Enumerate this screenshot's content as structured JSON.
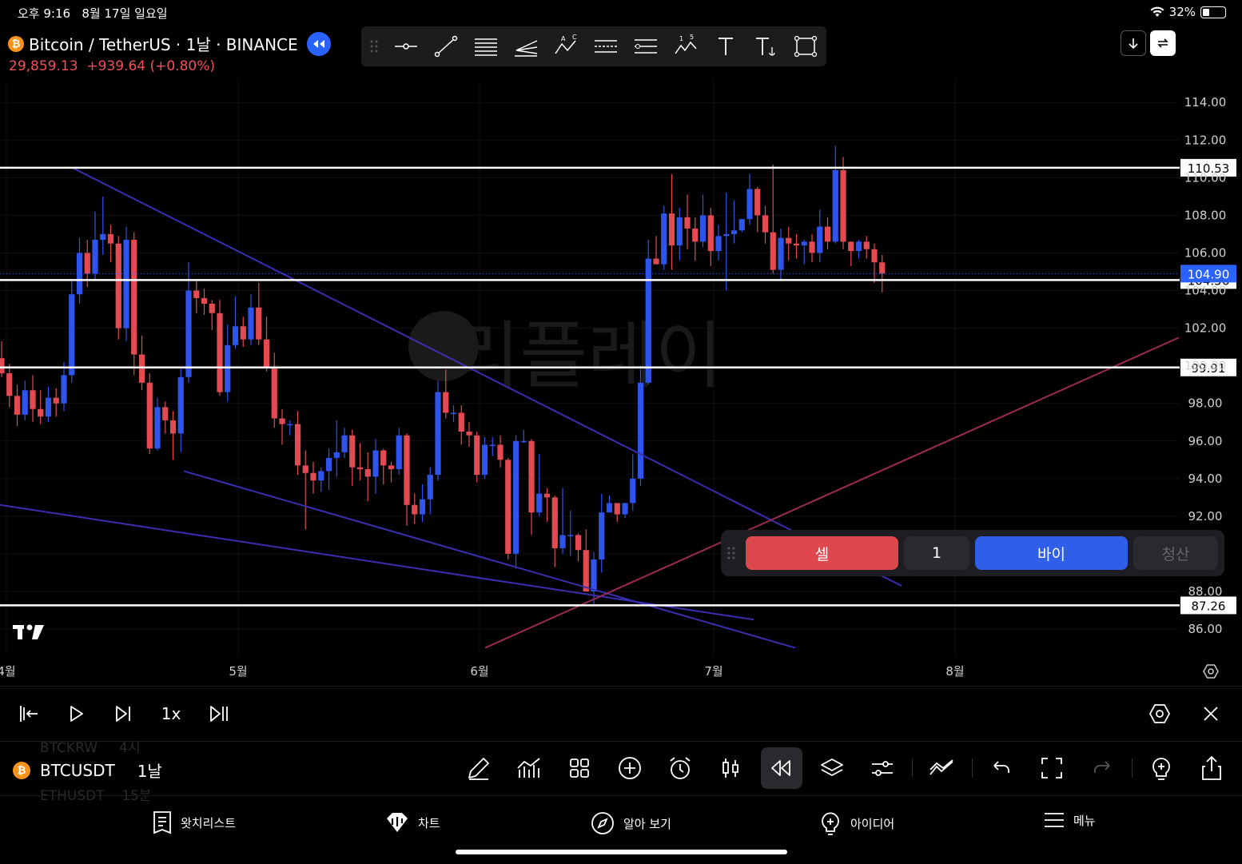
{
  "status_bar": {
    "time": "오후 9:16",
    "date": "8월 17일 일요일",
    "battery": "32%"
  },
  "symbol": {
    "title": "Bitcoin / TetherUS · 1날 · BINANCE",
    "price": "29,859.13",
    "change": "+939.64 (+0.80%)",
    "ticker": "BTCUSDT",
    "interval": "1날"
  },
  "watchlist_ghost": {
    "prev_ticker": "BTCKRW",
    "prev_interval": "4시",
    "next_ticker": "ETHUSDT",
    "next_interval": "15분"
  },
  "watermark": "리플레이",
  "chart_data": {
    "type": "candlestick",
    "y_axis": {
      "min": 84.6,
      "max": 115.2,
      "ticks": [
        "114.00",
        "112.00",
        "110.00",
        "108.00",
        "106.00",
        "104.00",
        "102.00",
        "100.00",
        "98.00",
        "96.00",
        "94.00",
        "92.00",
        "90.00",
        "88.00",
        "86.00"
      ]
    },
    "x_axis": {
      "labels": [
        "4월",
        "5월",
        "6월",
        "7월",
        "8월"
      ]
    },
    "horizontal_lines": [
      {
        "label": "110.53",
        "value": 110.53
      },
      {
        "label": "104.56",
        "value": 104.56
      },
      {
        "label": "99.91",
        "value": 99.91
      },
      {
        "label": "87.26",
        "value": 87.26
      }
    ],
    "current_price": {
      "label": "104.90",
      "value": 104.9
    },
    "colors": {
      "up": "#2f54eb",
      "down": "#e34a52",
      "trendline": "#3a2fb0",
      "support_line": "#9b2a56",
      "price_tag": "#2962ff"
    },
    "candles": [
      [
        100.4,
        99.6,
        101.3,
        99.4
      ],
      [
        99.6,
        98.4,
        100.1,
        97.8
      ],
      [
        98.4,
        97.4,
        99.0,
        96.8
      ],
      [
        97.4,
        98.7,
        99.2,
        97.1
      ],
      [
        98.7,
        97.7,
        99.5,
        97.0
      ],
      [
        97.7,
        97.3,
        98.7,
        96.9
      ],
      [
        97.3,
        98.3,
        98.9,
        97.0
      ],
      [
        98.3,
        98.0,
        98.8,
        97.3
      ],
      [
        98.0,
        99.5,
        100.2,
        97.6
      ],
      [
        99.5,
        103.8,
        104.5,
        99.1
      ],
      [
        103.8,
        106.0,
        106.8,
        103.3
      ],
      [
        106.0,
        104.9,
        106.7,
        104.2
      ],
      [
        104.9,
        106.7,
        108.2,
        104.6
      ],
      [
        106.7,
        107.0,
        109.0,
        105.9
      ],
      [
        107.0,
        106.5,
        107.5,
        105.5
      ],
      [
        106.5,
        102.0,
        106.9,
        101.4
      ],
      [
        102.0,
        106.7,
        107.4,
        101.3
      ],
      [
        106.7,
        100.6,
        107.1,
        99.5
      ],
      [
        100.6,
        99.1,
        101.6,
        98.7
      ],
      [
        99.1,
        95.6,
        99.6,
        95.3
      ],
      [
        95.6,
        97.8,
        98.3,
        95.5
      ],
      [
        97.8,
        97.1,
        98.1,
        96.4
      ],
      [
        97.1,
        96.4,
        97.6,
        95.0
      ],
      [
        96.4,
        99.4,
        99.9,
        95.4
      ],
      [
        99.4,
        104.0,
        105.5,
        99.1
      ],
      [
        104.0,
        103.6,
        104.6,
        102.8
      ],
      [
        103.6,
        103.3,
        104.1,
        102.7
      ],
      [
        103.3,
        102.8,
        103.5,
        101.9
      ],
      [
        102.8,
        98.6,
        103.5,
        98.4
      ],
      [
        98.6,
        101.1,
        102.2,
        98.1
      ],
      [
        101.1,
        102.1,
        103.7,
        100.9
      ],
      [
        102.1,
        101.4,
        102.6,
        101.0
      ],
      [
        101.4,
        103.1,
        103.8,
        101.1
      ],
      [
        103.1,
        101.4,
        104.4,
        101.1
      ],
      [
        101.4,
        99.9,
        102.6,
        99.7
      ],
      [
        99.9,
        97.2,
        100.7,
        96.7
      ],
      [
        97.2,
        96.9,
        97.7,
        95.8
      ],
      [
        96.9,
        96.9,
        97.1,
        96.3
      ],
      [
        96.9,
        94.7,
        97.6,
        94.2
      ],
      [
        94.7,
        94.3,
        95.5,
        91.3
      ],
      [
        94.3,
        93.9,
        94.9,
        93.2
      ],
      [
        93.9,
        94.4,
        94.6,
        93.3
      ],
      [
        94.4,
        95.1,
        95.6,
        93.4
      ],
      [
        95.1,
        95.4,
        97.1,
        94.1
      ],
      [
        95.4,
        96.3,
        96.7,
        95.1
      ],
      [
        96.3,
        94.6,
        96.6,
        93.6
      ],
      [
        94.6,
        94.5,
        95.9,
        93.9
      ],
      [
        94.5,
        94.1,
        95.4,
        92.8
      ],
      [
        94.1,
        95.5,
        96.1,
        93.2
      ],
      [
        95.5,
        94.7,
        95.6,
        93.7
      ],
      [
        94.7,
        94.5,
        94.9,
        93.8
      ],
      [
        94.5,
        96.3,
        96.7,
        94.2
      ],
      [
        96.3,
        92.6,
        96.4,
        91.5
      ],
      [
        92.6,
        92.1,
        93.2,
        91.6
      ],
      [
        92.1,
        92.9,
        93.7,
        91.7
      ],
      [
        92.9,
        94.2,
        94.6,
        92.1
      ],
      [
        94.2,
        98.6,
        99.2,
        93.9
      ],
      [
        98.6,
        97.5,
        99.8,
        97.2
      ],
      [
        97.5,
        97.5,
        97.9,
        97.0
      ],
      [
        97.5,
        96.5,
        97.9,
        95.8
      ],
      [
        96.5,
        96.3,
        97.0,
        95.7
      ],
      [
        96.3,
        94.2,
        96.5,
        93.8
      ],
      [
        94.2,
        95.8,
        96.2,
        94.0
      ],
      [
        95.8,
        95.8,
        96.2,
        95.2
      ],
      [
        95.8,
        95.0,
        96.3,
        94.6
      ],
      [
        95.0,
        90.0,
        95.1,
        89.7
      ],
      [
        90.0,
        96.0,
        96.3,
        89.2
      ],
      [
        96.0,
        96.0,
        96.6,
        95.9
      ],
      [
        96.0,
        92.2,
        96.1,
        91.0
      ],
      [
        92.2,
        93.2,
        95.3,
        92.0
      ],
      [
        93.2,
        93.0,
        93.5,
        91.7
      ],
      [
        93.0,
        90.3,
        93.1,
        89.3
      ],
      [
        90.3,
        91.0,
        93.5,
        90.0
      ],
      [
        91.0,
        91.0,
        92.3,
        89.9
      ],
      [
        91.0,
        90.2,
        91.1,
        89.6
      ],
      [
        90.2,
        88.0,
        91.3,
        88.0
      ],
      [
        88.0,
        89.7,
        90.1,
        87.2
      ],
      [
        89.7,
        92.2,
        93.2,
        89.0
      ],
      [
        92.2,
        92.7,
        93.1,
        92.5
      ],
      [
        92.7,
        92.1,
        92.7,
        91.7
      ],
      [
        92.1,
        92.7,
        92.7,
        91.9
      ],
      [
        92.7,
        94.0,
        95.3,
        92.3
      ],
      [
        94.0,
        99.1,
        100.0,
        93.6
      ],
      [
        99.1,
        105.7,
        106.7,
        99.0
      ],
      [
        105.7,
        105.4,
        106.9,
        105.5
      ],
      [
        105.4,
        108.1,
        108.5,
        105.1
      ],
      [
        108.1,
        106.4,
        110.2,
        105.1
      ],
      [
        106.4,
        107.9,
        108.4,
        105.6
      ],
      [
        107.9,
        107.3,
        109.1,
        106.2
      ],
      [
        107.3,
        106.6,
        107.9,
        105.6
      ],
      [
        106.6,
        108.0,
        109.1,
        106.3
      ],
      [
        108.0,
        106.1,
        108.4,
        105.3
      ],
      [
        106.1,
        106.9,
        107.5,
        105.6
      ],
      [
        106.9,
        107.0,
        109.2,
        104.0
      ],
      [
        107.0,
        107.2,
        108.8,
        106.5
      ],
      [
        107.2,
        107.8,
        107.8,
        107.1
      ],
      [
        107.8,
        109.4,
        110.2,
        107.5
      ],
      [
        109.4,
        108.0,
        109.5,
        107.1
      ],
      [
        108.0,
        107.1,
        108.5,
        106.5
      ],
      [
        107.1,
        105.1,
        110.7,
        104.9
      ],
      [
        105.1,
        106.8,
        107.3,
        104.5
      ],
      [
        106.8,
        106.5,
        107.4,
        105.6
      ],
      [
        106.5,
        106.4,
        107.0,
        105.7
      ],
      [
        106.4,
        106.6,
        106.7,
        105.4
      ],
      [
        106.6,
        106.0,
        107.0,
        105.5
      ],
      [
        106.0,
        107.4,
        108.3,
        105.5
      ],
      [
        107.4,
        106.6,
        107.9,
        106.2
      ],
      [
        106.6,
        110.4,
        111.7,
        106.5
      ],
      [
        110.4,
        106.6,
        111.1,
        106.2
      ],
      [
        106.6,
        106.1,
        106.6,
        105.3
      ],
      [
        106.1,
        106.6,
        106.7,
        105.7
      ],
      [
        106.6,
        106.2,
        106.9,
        105.7
      ],
      [
        106.2,
        105.5,
        106.5,
        104.4
      ],
      [
        105.5,
        104.9,
        105.9,
        103.9
      ]
    ]
  },
  "trade_panel": {
    "sell_label": "셀",
    "quantity": "1",
    "buy_label": "바이",
    "close_label": "청산"
  },
  "replay_controls": {
    "speed": "1x"
  },
  "nav": [
    {
      "label": "왓치리스트",
      "icon": "watchlist-icon"
    },
    {
      "label": "차트",
      "icon": "chart-icon"
    },
    {
      "label": "알아 보기",
      "icon": "explore-icon"
    },
    {
      "label": "아이디어",
      "icon": "ideas-icon"
    },
    {
      "label": "메뉴",
      "icon": "menu-icon"
    }
  ]
}
